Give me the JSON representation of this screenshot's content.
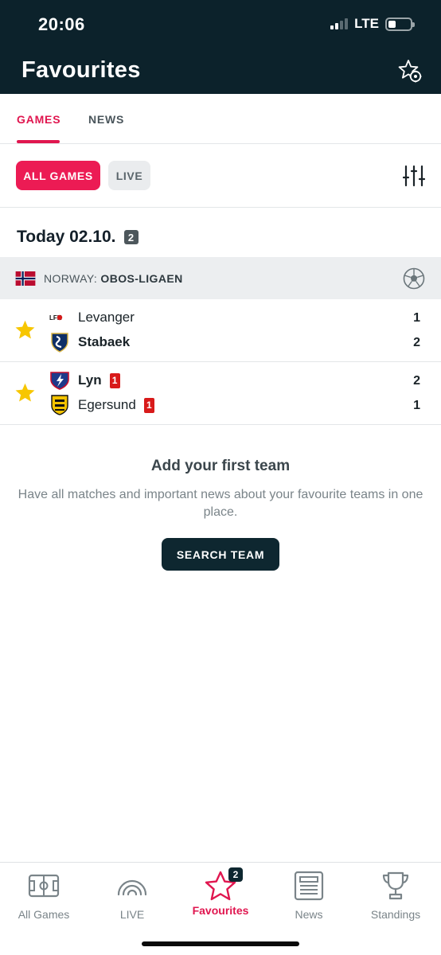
{
  "status_bar": {
    "time": "20:06",
    "network": "LTE"
  },
  "header": {
    "title": "Favourites"
  },
  "tabs": [
    {
      "label": "GAMES",
      "active": true
    },
    {
      "label": "NEWS",
      "active": false
    }
  ],
  "filters": {
    "all_games": "ALL GAMES",
    "live": "LIVE"
  },
  "date_section": {
    "label": "Today 02.10.",
    "count": "2"
  },
  "league": {
    "country": "NORWAY:",
    "name": "OBOS-LIGAEN"
  },
  "matches": [
    {
      "home": {
        "name": "Levanger",
        "logo_text": "LFK",
        "red_cards": "",
        "score": "1"
      },
      "away": {
        "name": "Stabaek",
        "red_cards": "",
        "score": "2"
      }
    },
    {
      "home": {
        "name": "Lyn",
        "red_cards": "1",
        "score": "2"
      },
      "away": {
        "name": "Egersund",
        "red_cards": "1",
        "score": "1"
      }
    }
  ],
  "empty_state": {
    "title": "Add your first team",
    "text": "Have all matches and important news about your favourite teams in one place.",
    "button": "SEARCH TEAM"
  },
  "bottom_nav": [
    {
      "label": "All Games",
      "icon": "pitch-icon"
    },
    {
      "label": "LIVE",
      "icon": "live-signal-icon"
    },
    {
      "label": "Favourites",
      "icon": "star-icon",
      "badge": "2",
      "active": true
    },
    {
      "label": "News",
      "icon": "newspaper-icon"
    },
    {
      "label": "Standings",
      "icon": "trophy-icon"
    }
  ],
  "colors": {
    "header_bg": "#0c222b",
    "accent": "#e0164f",
    "star": "#f7c600",
    "red_card": "#d81a1a"
  }
}
